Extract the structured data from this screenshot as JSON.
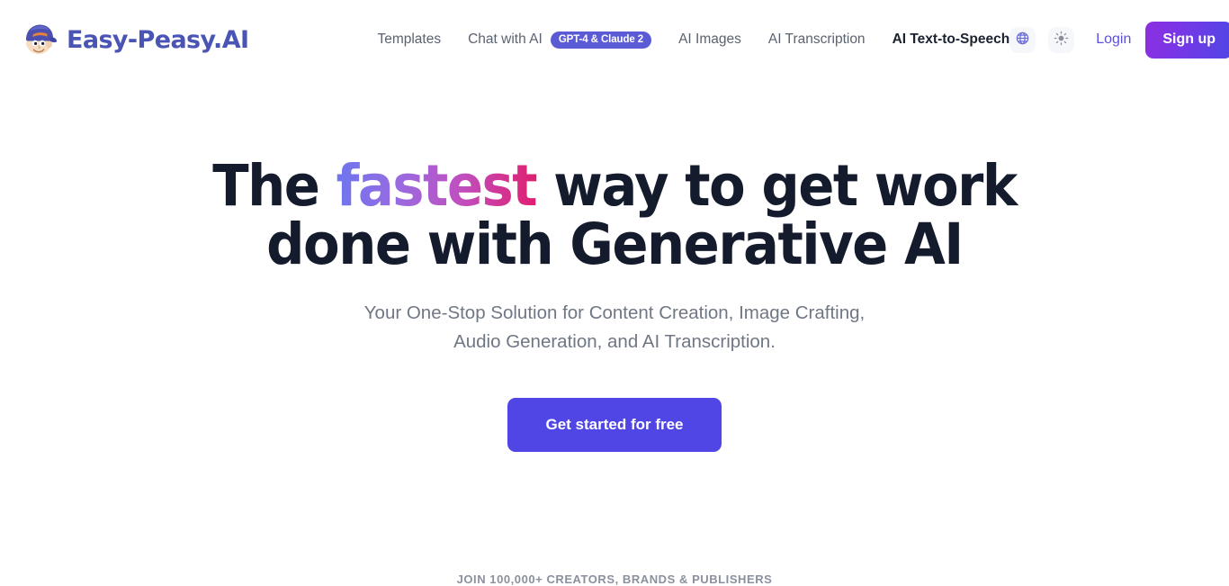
{
  "header": {
    "logo": {
      "name": "Easy-Peasy.AI",
      "icon": "mascot-face-icon"
    },
    "nav": [
      {
        "label": "Templates",
        "active": false,
        "badge": null
      },
      {
        "label": "Chat with AI",
        "active": false,
        "badge": "GPT-4 & Claude 2"
      },
      {
        "label": "AI Images",
        "active": false,
        "badge": null
      },
      {
        "label": "AI Transcription",
        "active": false,
        "badge": null
      },
      {
        "label": "AI Text-to-Speech",
        "active": true,
        "badge": null
      }
    ],
    "language_icon": "globe-icon",
    "theme_icon": "sun-icon",
    "login_label": "Login",
    "signup_label": "Sign up"
  },
  "hero": {
    "headline_part1": "The ",
    "headline_highlight": "fastest",
    "headline_part2": " way to get work done with Generative AI",
    "subtitle_line1": "Your One-Stop Solution for Content Creation, Image Crafting,",
    "subtitle_line2": "Audio Generation, and AI Transcription.",
    "cta_label": "Get started for free"
  },
  "social_proof": {
    "text": "JOIN 100,000+ CREATORS, BRANDS & PUBLISHERS"
  },
  "colors": {
    "brand_indigo": "#4f46e5",
    "logo_blue": "#4a54b5",
    "badge_indigo": "#5b5bd6",
    "headline_dark": "#141b2d",
    "muted_text": "#707784",
    "link_purple": "#5b52d8"
  }
}
